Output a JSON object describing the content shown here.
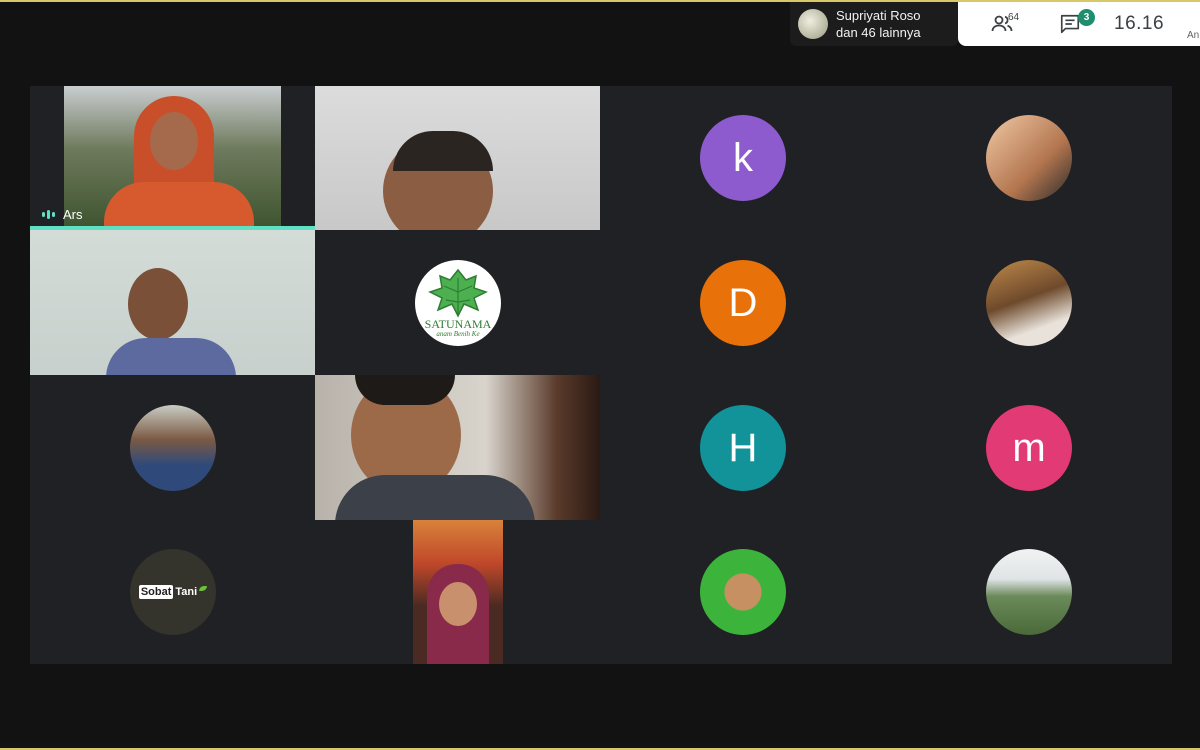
{
  "presenter": {
    "name": "Supriyati Roso",
    "others": "dan 46 lainnya"
  },
  "top_bar": {
    "people_count": "64",
    "chat_badge": "3",
    "clock": "16.16",
    "truncated_label": "An"
  },
  "tiles": {
    "arsi": {
      "name": "Ars"
    },
    "k": {
      "letter": "k",
      "color": "#8e5bcf"
    },
    "d": {
      "letter": "D",
      "color": "#e8710a"
    },
    "h": {
      "letter": "H",
      "color": "#12939a"
    },
    "m": {
      "letter": "m",
      "color": "#e23a74"
    },
    "satunama": {
      "logo_text": "SATUNAMA",
      "logo_sub": "anam Benih Ke"
    },
    "sobat_tani": {
      "word1": "Sobat",
      "word2": "Tani"
    }
  },
  "colors": {
    "background": "#121212",
    "grid": "#202124",
    "accent": "#5fe0c4",
    "top_border": "#d8c86a"
  }
}
